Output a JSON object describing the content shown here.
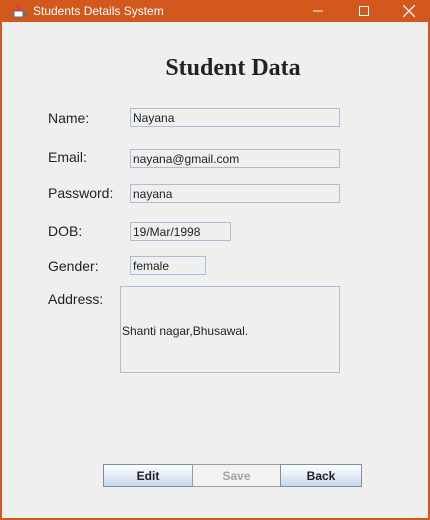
{
  "window": {
    "title": "Students Details System",
    "app_icon": "java-icon",
    "controls": [
      "minimize-icon",
      "maximize-icon",
      "close-icon"
    ]
  },
  "heading": "Student Data",
  "form": {
    "name_label": "Name:",
    "name_value": "Nayana",
    "email_label": "Email:",
    "email_value": "nayana@gmail.com",
    "password_label": "Password:",
    "password_value": "nayana",
    "dob_label": "DOB:",
    "dob_value": "19/Mar/1998",
    "gender_label": "Gender:",
    "gender_value": "female",
    "address_label": "Address:",
    "address_value": "Shanti nagar,Bhusawal."
  },
  "buttons": {
    "edit": "Edit",
    "save": "Save",
    "back": "Back"
  },
  "colors": {
    "titlebar": "#d2581d",
    "field_border": "#a9bfd6",
    "background": "#efefef"
  }
}
